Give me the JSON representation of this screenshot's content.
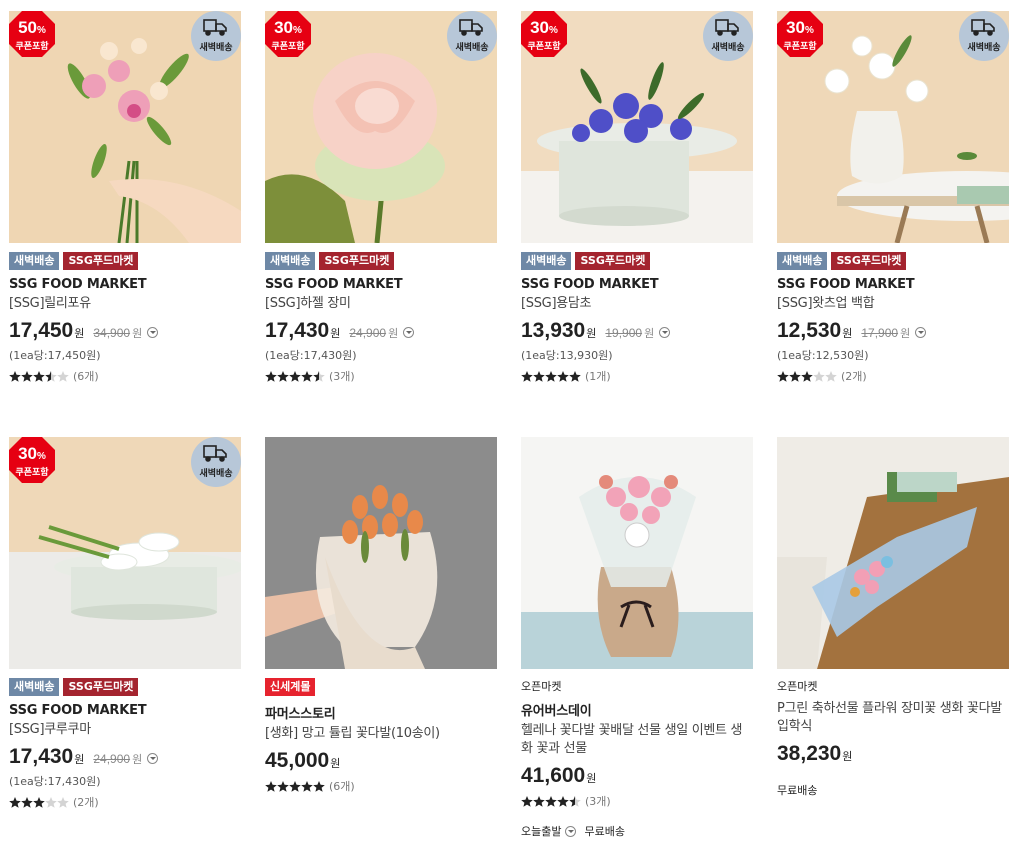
{
  "products": [
    {
      "coupon_pct": "50",
      "coupon_pct_unit": "%",
      "coupon_label": "쿠폰포함",
      "dawn_label": "새벽배송",
      "tags": [
        "새벽배송",
        "SSG푸드마켓"
      ],
      "brand": "SSG FOOD MARKET",
      "name": "[SSG]릴리포유",
      "price": "17,450",
      "won": "원",
      "orig": "34,900",
      "orig_won": "원",
      "unit_price": "(1ea당:17,450원)",
      "rating": 3.5,
      "reviews": "(6개)"
    },
    {
      "coupon_pct": "30",
      "coupon_pct_unit": "%",
      "coupon_label": "쿠폰포함",
      "dawn_label": "새벽배송",
      "tags": [
        "새벽배송",
        "SSG푸드마켓"
      ],
      "brand": "SSG FOOD MARKET",
      "name": "[SSG]하젤 장미",
      "price": "17,430",
      "won": "원",
      "orig": "24,900",
      "orig_won": "원",
      "unit_price": "(1ea당:17,430원)",
      "rating": 4.5,
      "reviews": "(3개)"
    },
    {
      "coupon_pct": "30",
      "coupon_pct_unit": "%",
      "coupon_label": "쿠폰포함",
      "dawn_label": "새벽배송",
      "tags": [
        "새벽배송",
        "SSG푸드마켓"
      ],
      "brand": "SSG FOOD MARKET",
      "name": "[SSG]용담초",
      "price": "13,930",
      "won": "원",
      "orig": "19,900",
      "orig_won": "원",
      "unit_price": "(1ea당:13,930원)",
      "rating": 5,
      "reviews": "(1개)"
    },
    {
      "coupon_pct": "30",
      "coupon_pct_unit": "%",
      "coupon_label": "쿠폰포함",
      "dawn_label": "새벽배송",
      "tags": [
        "새벽배송",
        "SSG푸드마켓"
      ],
      "brand": "SSG FOOD MARKET",
      "name": "[SSG]왓츠업 백합",
      "price": "12,530",
      "won": "원",
      "orig": "17,900",
      "orig_won": "원",
      "unit_price": "(1ea당:12,530원)",
      "rating": 3,
      "reviews": "(2개)"
    },
    {
      "coupon_pct": "30",
      "coupon_pct_unit": "%",
      "coupon_label": "쿠폰포함",
      "dawn_label": "새벽배송",
      "tags": [
        "새벽배송",
        "SSG푸드마켓"
      ],
      "brand": "SSG FOOD MARKET",
      "name": "[SSG]쿠루쿠마",
      "price": "17,430",
      "won": "원",
      "orig": "24,900",
      "orig_won": "원",
      "unit_price": "(1ea당:17,430원)",
      "rating": 3,
      "reviews": "(2개)"
    },
    {
      "tag_single": "신세계몰",
      "brand": "파머스스토리",
      "name": "[생화] 망고 튤립 꽃다발(10송이)",
      "price": "45,000",
      "won": "원",
      "rating": 5,
      "reviews": "(6개)"
    },
    {
      "market": "오픈마켓",
      "brand": "유어버스데이",
      "name": "헬레나 꽃다발 꽃배달 선물 생일 이벤트 생화 꽃과 선물",
      "price": "41,600",
      "won": "원",
      "rating": 4.5,
      "reviews": "(3개)",
      "extra_1": "오늘출발",
      "extra_2": "무료배송"
    },
    {
      "market": "오픈마켓",
      "name": "P그린 축하선물 플라워 장미꽃 생화 꽃다발 입학식",
      "price": "38,230",
      "won": "원",
      "extra_2": "무료배송"
    }
  ],
  "colors": {
    "coupon_red": "#e60012",
    "dawn_badge": "#b7c7d8",
    "tag_gray": "#6e88a6",
    "tag_red": "#a4242f",
    "star": "#222222"
  }
}
